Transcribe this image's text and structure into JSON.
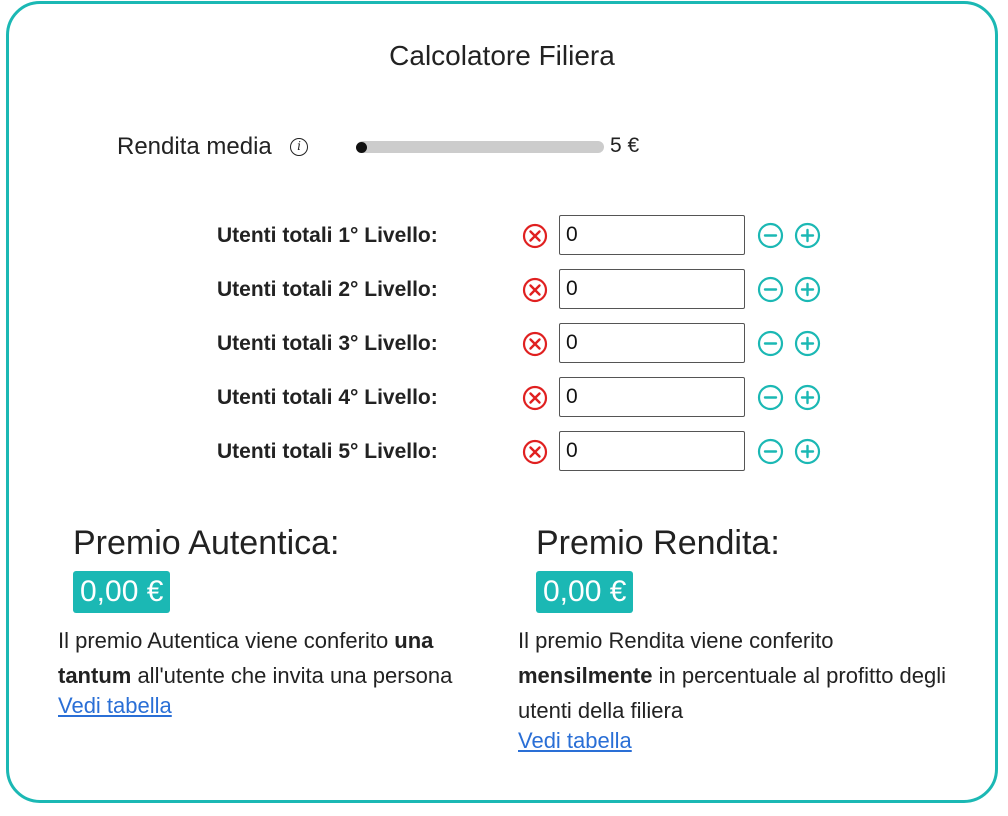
{
  "title": "Calcolatore Filiera",
  "rendita": {
    "label": "Rendita media",
    "info_icon": "info-icon",
    "value_label": "5 €",
    "slider_fraction": 0.0
  },
  "levels": [
    {
      "label": "Utenti totali 1° Livello:",
      "value": "0"
    },
    {
      "label": "Utenti totali 2° Livello:",
      "value": "0"
    },
    {
      "label": "Utenti totali 3° Livello:",
      "value": "0"
    },
    {
      "label": "Utenti totali 4° Livello:",
      "value": "0"
    },
    {
      "label": "Utenti totali 5° Livello:",
      "value": "0"
    }
  ],
  "icons": {
    "clear": "clear-circle-x-icon",
    "minus": "minus-circle-icon",
    "plus": "plus-circle-icon"
  },
  "colors": {
    "accent": "#1bb8b4",
    "clear": "#e02020",
    "link": "#2a6fd6"
  },
  "premio_autentica": {
    "title": "Premio Autentica:",
    "amount": "0,00 €",
    "desc_before": "Il premio Autentica viene conferito ",
    "desc_bold": "una tantum",
    "desc_after": " all'utente che invita una persona",
    "link": "Vedi tabella"
  },
  "premio_rendita": {
    "title": "Premio Rendita:",
    "amount": "0,00 €",
    "desc_before": "Il premio Rendita viene conferito ",
    "desc_bold": "mensilmente",
    "desc_after": " in percentuale al profitto degli utenti della filiera",
    "link": "Vedi tabella"
  }
}
